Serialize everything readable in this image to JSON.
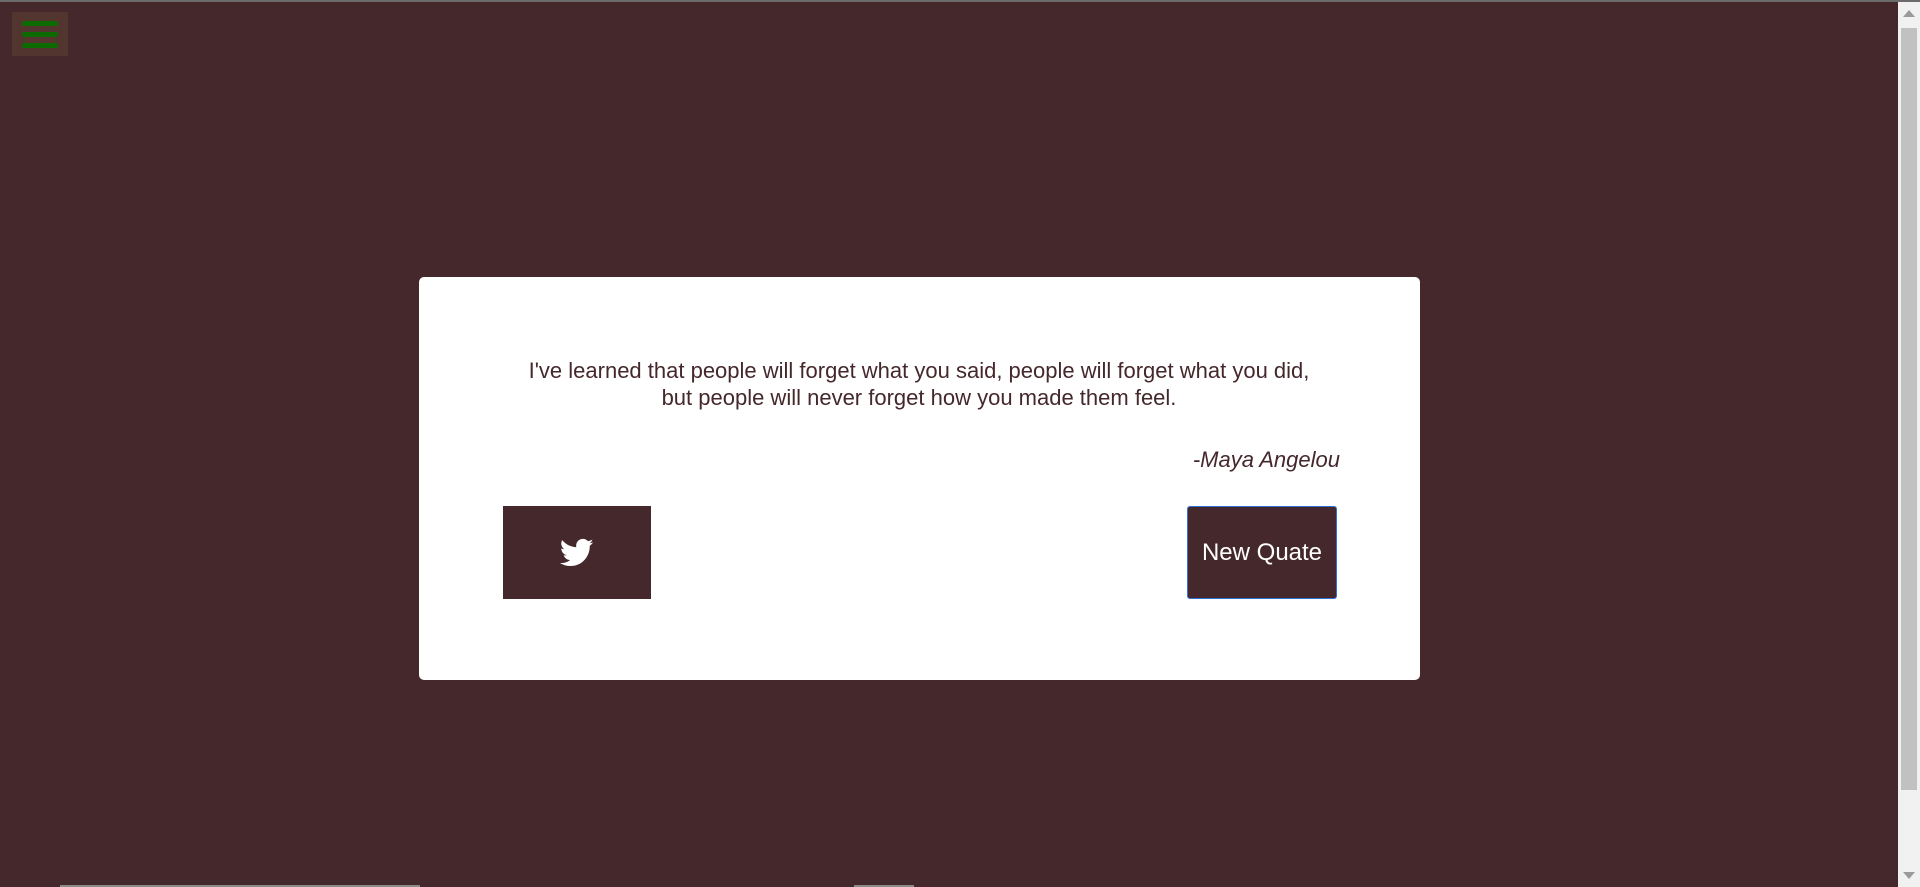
{
  "menu": {
    "icon": "hamburger-menu-icon",
    "icon_color": "#0b6b00"
  },
  "quote": {
    "text": "I've learned that people will forget what you said, people will forget what you did, but people will never forget how you made them feel.",
    "author": "-Maya Angelou"
  },
  "actions": {
    "tweet_icon": "twitter-bird-icon",
    "new_quote_label": "New Quate"
  },
  "colors": {
    "background": "#45282c",
    "card": "#ffffff",
    "accent_border": "#2f6fd6"
  }
}
